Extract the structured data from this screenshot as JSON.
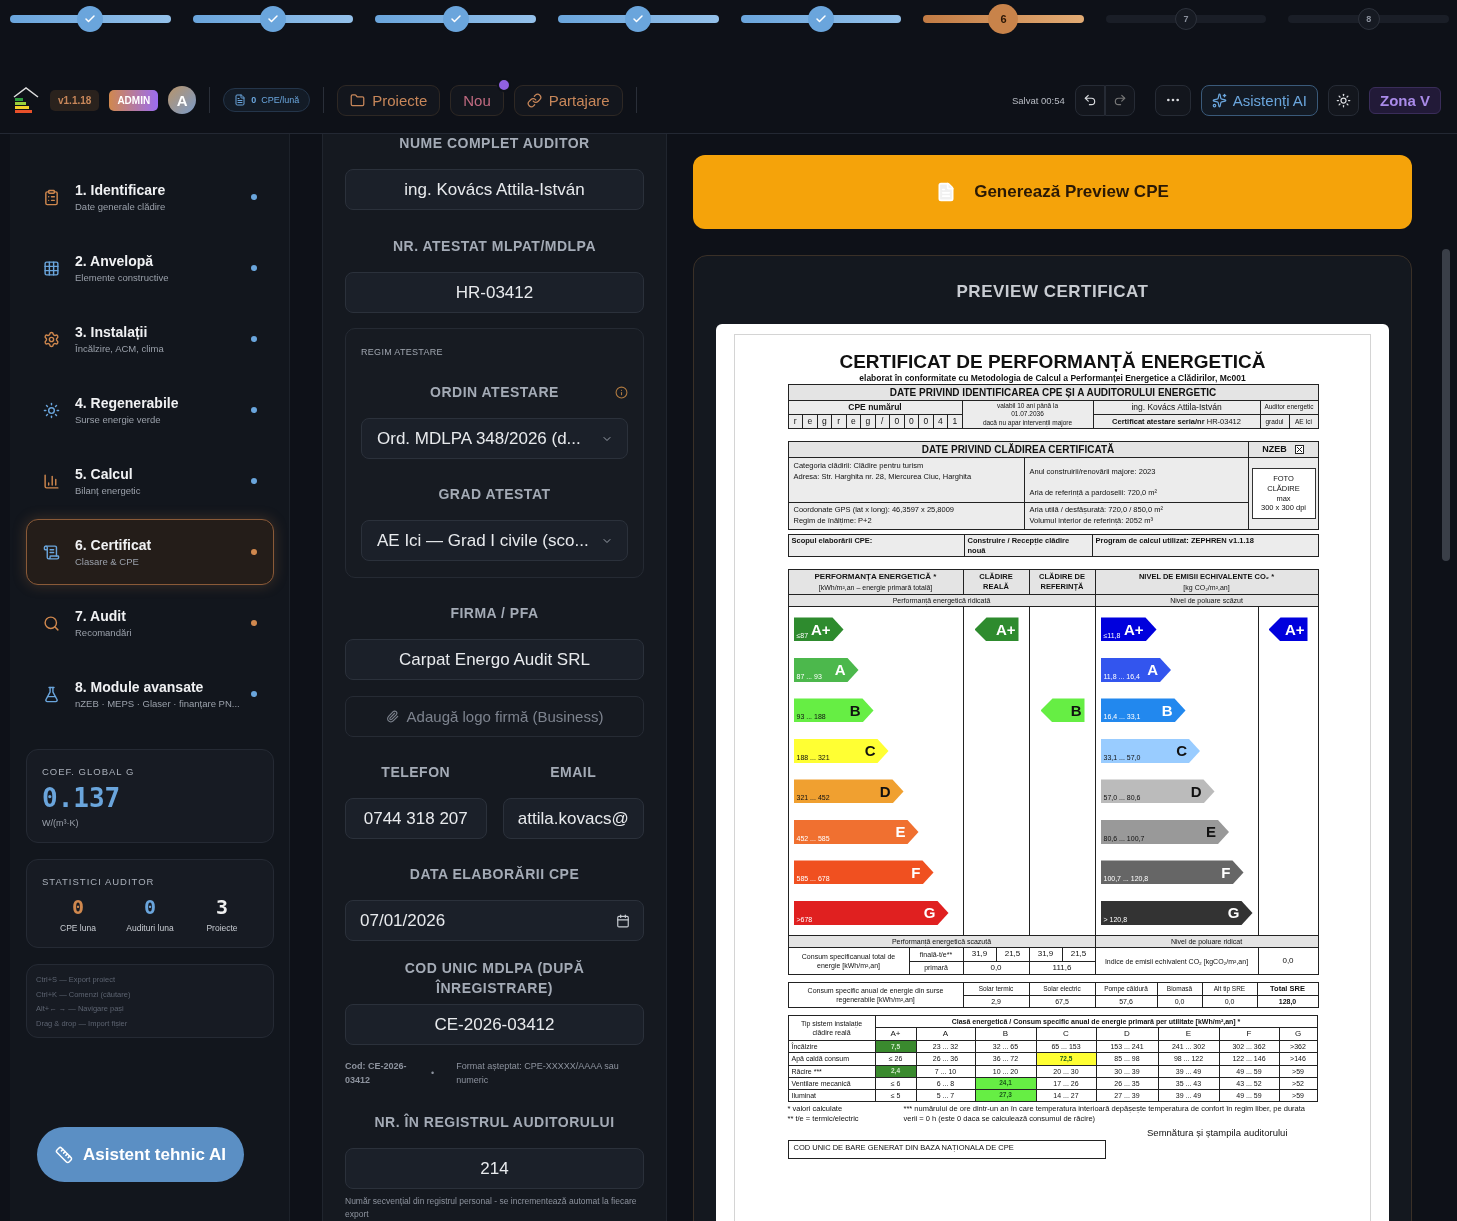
{
  "stepper": [
    {
      "done": true,
      "selected": false
    },
    {
      "done": true,
      "selected": false
    },
    {
      "done": true,
      "selected": false
    },
    {
      "done": true,
      "selected": false
    },
    {
      "done": true,
      "selected": false
    },
    {
      "done": false,
      "selected": true,
      "label": "6"
    },
    {
      "done": false,
      "selected": false,
      "label": "7"
    },
    {
      "done": false,
      "selected": false,
      "label": "8"
    }
  ],
  "header": {
    "version": "v1.1.18",
    "role": "ADMIN",
    "avatar": "A",
    "cpe_count": "0",
    "cpe_unit": "CPE/lună",
    "buttons": [
      {
        "kind": "folder",
        "label": "Proiecte",
        "notification": false
      },
      {
        "kind": "new",
        "label": "Nou",
        "notification": true
      },
      {
        "kind": "share",
        "label": "Partajare",
        "notification": false
      }
    ],
    "saved": "Salvat 00:54",
    "ai_button": "Asistenți AI",
    "zone": "Zona V"
  },
  "sidebar": {
    "items": [
      {
        "title": "1. Identificare",
        "subtitle": "Date generale clădire",
        "color": "#6aa5dc",
        "selected": false
      },
      {
        "title": "2. Anvelopă",
        "subtitle": "Elemente constructive",
        "color": "#6aa5dc",
        "selected": false
      },
      {
        "title": "3. Instalații",
        "subtitle": "Încălzire, ACM, clima",
        "color": "#6aa5dc",
        "selected": false
      },
      {
        "title": "4. Regenerabile",
        "subtitle": "Surse energie verde",
        "color": "#6aa5dc",
        "selected": false
      },
      {
        "title": "5. Calcul",
        "subtitle": "Bilanț energetic",
        "color": "#6aa5dc",
        "selected": false
      },
      {
        "title": "6. Certificat",
        "subtitle": "Clasare & CPE",
        "color": "#d0884e",
        "selected": true
      },
      {
        "title": "7. Audit",
        "subtitle": "Recomandări",
        "color": "#d0884e",
        "selected": false
      },
      {
        "title": "8. Module avansate",
        "subtitle": "nZEB · MEPS · Glaser · finanțare PN...",
        "color": "#6aa5dc",
        "selected": false
      }
    ],
    "coefficient": {
      "label": "COEF. GLOBAL G",
      "value": "0.137",
      "unit": "W/(m³·K)"
    },
    "stats": {
      "title": "STATISTICI AUDITOR",
      "items": [
        {
          "value": "0",
          "label": "CPE luna",
          "color": "#d0884e"
        },
        {
          "value": "0",
          "label": "Audituri luna",
          "color": "#6aa5dc"
        },
        {
          "value": "3",
          "label": "Proiecte",
          "color": "#f0f0f0"
        }
      ]
    },
    "shortcuts": [
      "Ctrl+S — Export proiect",
      "Ctrl+K — Comenzi (căutare)",
      "Alt+← → — Navigare pași",
      "Drag & drop — Import fișier"
    ],
    "assistant_button": "Asistent tehnic AI"
  },
  "form": {
    "auditor_name": {
      "label": "NUME COMPLET AUDITOR",
      "value": "ing. Kovács Attila-István"
    },
    "attestation_number": {
      "label": "NR. ATESTAT MLPAT/MDLPA",
      "value": "HR-03412"
    },
    "regime": {
      "caption": "REGIM ATESTARE",
      "order": {
        "label": "ORDIN ATESTARE",
        "value": "Ord. MDLPA 348/2026 (d..."
      },
      "grade": {
        "label": "GRAD ATESTAT",
        "value": "AE Ici — Grad I civile (sco..."
      }
    },
    "company": {
      "label": "FIRMA / PFA",
      "value": "Carpat Energo Audit SRL"
    },
    "logo_upload": {
      "label": "Adaugă logo firmă (Business)"
    },
    "phone": {
      "label": "TELEFON",
      "value": "0744 318 207"
    },
    "email": {
      "label": "EMAIL",
      "value": "attila.kovacs@"
    },
    "date": {
      "label": "DATA ELABORĂRII CPE",
      "value": "07/01/2026"
    },
    "unique_code": {
      "label": "COD UNIC MDLPA (DUPĂ ÎNREGISTRARE)",
      "value": "CE-2026-03412",
      "code_note": "Cod: CE-2026-03412",
      "separator": "•",
      "format_note": "Format așteptat: CPE-XXXXX/AAAA sau numeric"
    },
    "registry": {
      "label": "NR. ÎN REGISTRUL AUDITORULUI",
      "value": "214",
      "hint": "Număr secvențial din registrul personal - se incrementează automat la fiecare export"
    }
  },
  "preview": {
    "generate_button": "Generează Preview CPE",
    "title": "PREVIEW CERTIFICAT",
    "certificate": {
      "title": "CERTIFICAT DE PERFORMANȚĂ ENERGETICĂ",
      "subtitle": "elaborat în conformitate cu Metodologia de Calcul a Performanței Energetice a Clădirilor, Mc001",
      "identification": {
        "heading": "DATE PRIVIND IDENTIFICAREA CPE ȘI A AUDITORULUI ENERGETIC",
        "cpe_label": "CPE numărul",
        "cpe_chars": [
          "r",
          "e",
          "g",
          "r",
          "e",
          "g",
          "/",
          "0",
          "0",
          "0",
          "4",
          "1"
        ],
        "validity": [
          "valabil 10 ani până la",
          "01.07.2036",
          "dacă nu apar intervenții majore"
        ],
        "auditor_name": "ing. Kovács Attila-István",
        "auditor_role": "Auditor energetic",
        "attestation": "**Certificat atestare seria/nr** HR-03412",
        "grade_label": "gradul",
        "grade_value": "AE Ici"
      },
      "building": {
        "heading": "DATE PRIVIND CLĂDIREA CERTIFICATĂ",
        "nzeb_label": "NZEB",
        "nzeb_checked": true,
        "rows": [
          {
            "left": [
              "Categoria clădirii: Clădire pentru turism",
              "Adresa: Str. Harghita nr. 28, Miercurea Ciuc, Harghita"
            ],
            "right": [
              "Anul construirii/renovării majore: 2023",
              "Aria de referință a pardoselii: 720,0 m²"
            ]
          },
          {
            "left": [
              "Coordonate GPS (lat x long): 46,3597 x 25,8009",
              "Regim de înălțime: P+2"
            ],
            "right": [
              "Aria utilă / desfășurată: 720,0 / 850,0 m²",
              "Volumul interior de referință: 2052 m³"
            ]
          }
        ],
        "photo": [
          "FOTO",
          "CLĂDIRE",
          "max",
          "300 x 300 dpi"
        ]
      },
      "purpose": {
        "label": "Scopul elaborării CPE:",
        "value": "Construire / Recepție clădire nouă",
        "program": "Program de calcul utilizat: ZEPHREN v1.1.18"
      },
      "performance": {
        "energy_heading": "PERFORMANȚA ENERGETICĂ *",
        "energy_unit": "[kWh/m²,an – energie primară totală]",
        "real_heading": "CLĂDIRE REALĂ",
        "reference_heading": "CLĂDIRE DE REFERINȚĂ",
        "co2_heading": "NIVEL DE EMISII ECHIVALENTE CO₂ *",
        "co2_unit": "[kg CO₂/m²,an]",
        "energy_top": "Performanță energetică ridicată",
        "co2_top": "Nivel de poluare scăzut",
        "energy_classes": [
          {
            "letter": "A+",
            "range": "≤87",
            "color": "#2e8b2e",
            "real_label": "A+"
          },
          {
            "letter": "A",
            "range": "87 ... 93",
            "color": "#4cb84c"
          },
          {
            "letter": "B",
            "range": "93 ... 188",
            "color": "#66ee44",
            "reference_label": "B"
          },
          {
            "letter": "C",
            "range": "188 ... 321",
            "color": "#ffff33"
          },
          {
            "letter": "D",
            "range": "321 ... 452",
            "color": "#f0a030"
          },
          {
            "letter": "E",
            "range": "452 ... 585",
            "color": "#f07030"
          },
          {
            "letter": "F",
            "range": "585 ... 678",
            "color": "#f05020"
          },
          {
            "letter": "G",
            "range": ">678",
            "color": "#e02020"
          }
        ],
        "co2_classes": [
          {
            "letter": "A+",
            "range": "≤11,8",
            "color": "#0000dd",
            "real_label": "A+"
          },
          {
            "letter": "A",
            "range": "11,8 ... 16,4",
            "color": "#3355ee"
          },
          {
            "letter": "B",
            "range": "16,4 ... 33,1",
            "color": "#2288ee"
          },
          {
            "letter": "C",
            "range": "33,1 ... 57,0",
            "color": "#99ccff"
          },
          {
            "letter": "D",
            "range": "57,0 ... 80,6",
            "color": "#bbbbbb"
          },
          {
            "letter": "E",
            "range": "80,6 ... 100,7",
            "color": "#999999"
          },
          {
            "letter": "F",
            "range": "100,7 ... 120,8",
            "color": "#666666"
          },
          {
            "letter": "G",
            "range": "> 120,8",
            "color": "#333333"
          }
        ],
        "energy_bottom": "Performanță energetică scazută",
        "co2_bottom": "Nivel de poluare ridicat",
        "consumption_label": "Consum specificanual total de energie [kWh/m²,an]",
        "final_label": "finală-t/e**",
        "primary_label": "primară",
        "real_final": [
          "31,9",
          "21,5"
        ],
        "reference_final": [
          "31,9",
          "21,5"
        ],
        "real_primary": "0,0",
        "reference_primary": "111,6",
        "co2_index_label": "Indice de emisii echivalent CO₂ [kgCO₂/m²,an]",
        "co2_index_value": "0,0"
      },
      "renewables": {
        "label": "Consum specific anual de energie din surse regenerabile [kWh/m²,an]",
        "columns": [
          {
            "name": "Solar termic",
            "value": "2,9"
          },
          {
            "name": "Solar electric",
            "value": "67,5"
          },
          {
            "name": "Pompe căldură",
            "value": "57,6"
          },
          {
            "name": "Biomasă",
            "value": "0,0"
          },
          {
            "name": "Alt tip SRE",
            "value": "0,0"
          },
          {
            "name": "Total SRE",
            "value": "128,0"
          }
        ]
      },
      "class_table": {
        "row_header": "Tip sistem instalație clădire reală",
        "title": "Clasă energetică / Consum specific anual de energie primară per utilitate [kWh/m²,an] *",
        "classes": [
          "A+",
          "A",
          "B",
          "C",
          "D",
          "E",
          "F",
          "G"
        ],
        "rows": [
          {
            "name": "Încălzire",
            "cells": [
              {
                "text": "7,5",
                "color": "#3a8a2e"
              },
              {
                "text": "23 ... 32"
              },
              {
                "text": "32 ... 65"
              },
              {
                "text": "65 ... 153"
              },
              {
                "text": "153 ... 241"
              },
              {
                "text": "241 ... 302"
              },
              {
                "text": "302 ... 362"
              },
              {
                "text": ">362"
              }
            ]
          },
          {
            "name": "Apă caldă consum",
            "cells": [
              {
                "text": "≤ 26"
              },
              {
                "text": "26 ... 36"
              },
              {
                "text": "36 ... 72"
              },
              {
                "text": "72,5",
                "color": "#ffff33"
              },
              {
                "text": "85 ... 98"
              },
              {
                "text": "98 ... 122"
              },
              {
                "text": "122 ... 146"
              },
              {
                "text": ">146"
              }
            ]
          },
          {
            "name": "Răcire ***",
            "cells": [
              {
                "text": "2,4",
                "color": "#3a8a2e"
              },
              {
                "text": "7 ... 10"
              },
              {
                "text": "10 ... 20"
              },
              {
                "text": "20 ... 30"
              },
              {
                "text": "30 ... 39"
              },
              {
                "text": "39 ... 49"
              },
              {
                "text": "49 ... 59"
              },
              {
                "text": ">59"
              }
            ]
          },
          {
            "name": "Ventilare mecanică",
            "cells": [
              {
                "text": "≤ 6"
              },
              {
                "text": "6 ... 8"
              },
              {
                "text": "24,1",
                "color": "#66ee44"
              },
              {
                "text": "17 ... 26"
              },
              {
                "text": "26 ... 35"
              },
              {
                "text": "35 ... 43"
              },
              {
                "text": "43 ... 52"
              },
              {
                "text": ">52"
              }
            ]
          },
          {
            "name": "Iluminat",
            "cells": [
              {
                "text": "≤ 5"
              },
              {
                "text": "5 ... 7"
              },
              {
                "text": "27,3",
                "color": "#66ee44"
              },
              {
                "text": "14 ... 27"
              },
              {
                "text": "27 ... 39"
              },
              {
                "text": "39 ... 49"
              },
              {
                "text": "49 ... 59"
              },
              {
                "text": ">59"
              }
            ]
          }
        ]
      },
      "notes": [
        "* valori calculate",
        "** t/e = termic/electric"
      ],
      "note_hours": "*** numărului de ore dintr-un an în care temperatura interioară depășește temperatura de confort în regim liber, pe durata verii = 0 h (este 0 daca se calculează consumul de răcire)",
      "signature": "Semnătura și ștampila auditorului",
      "barcode_label": "COD UNIC DE BARE GENERAT DIN BAZA NAȚIONALA DE CPE"
    }
  }
}
